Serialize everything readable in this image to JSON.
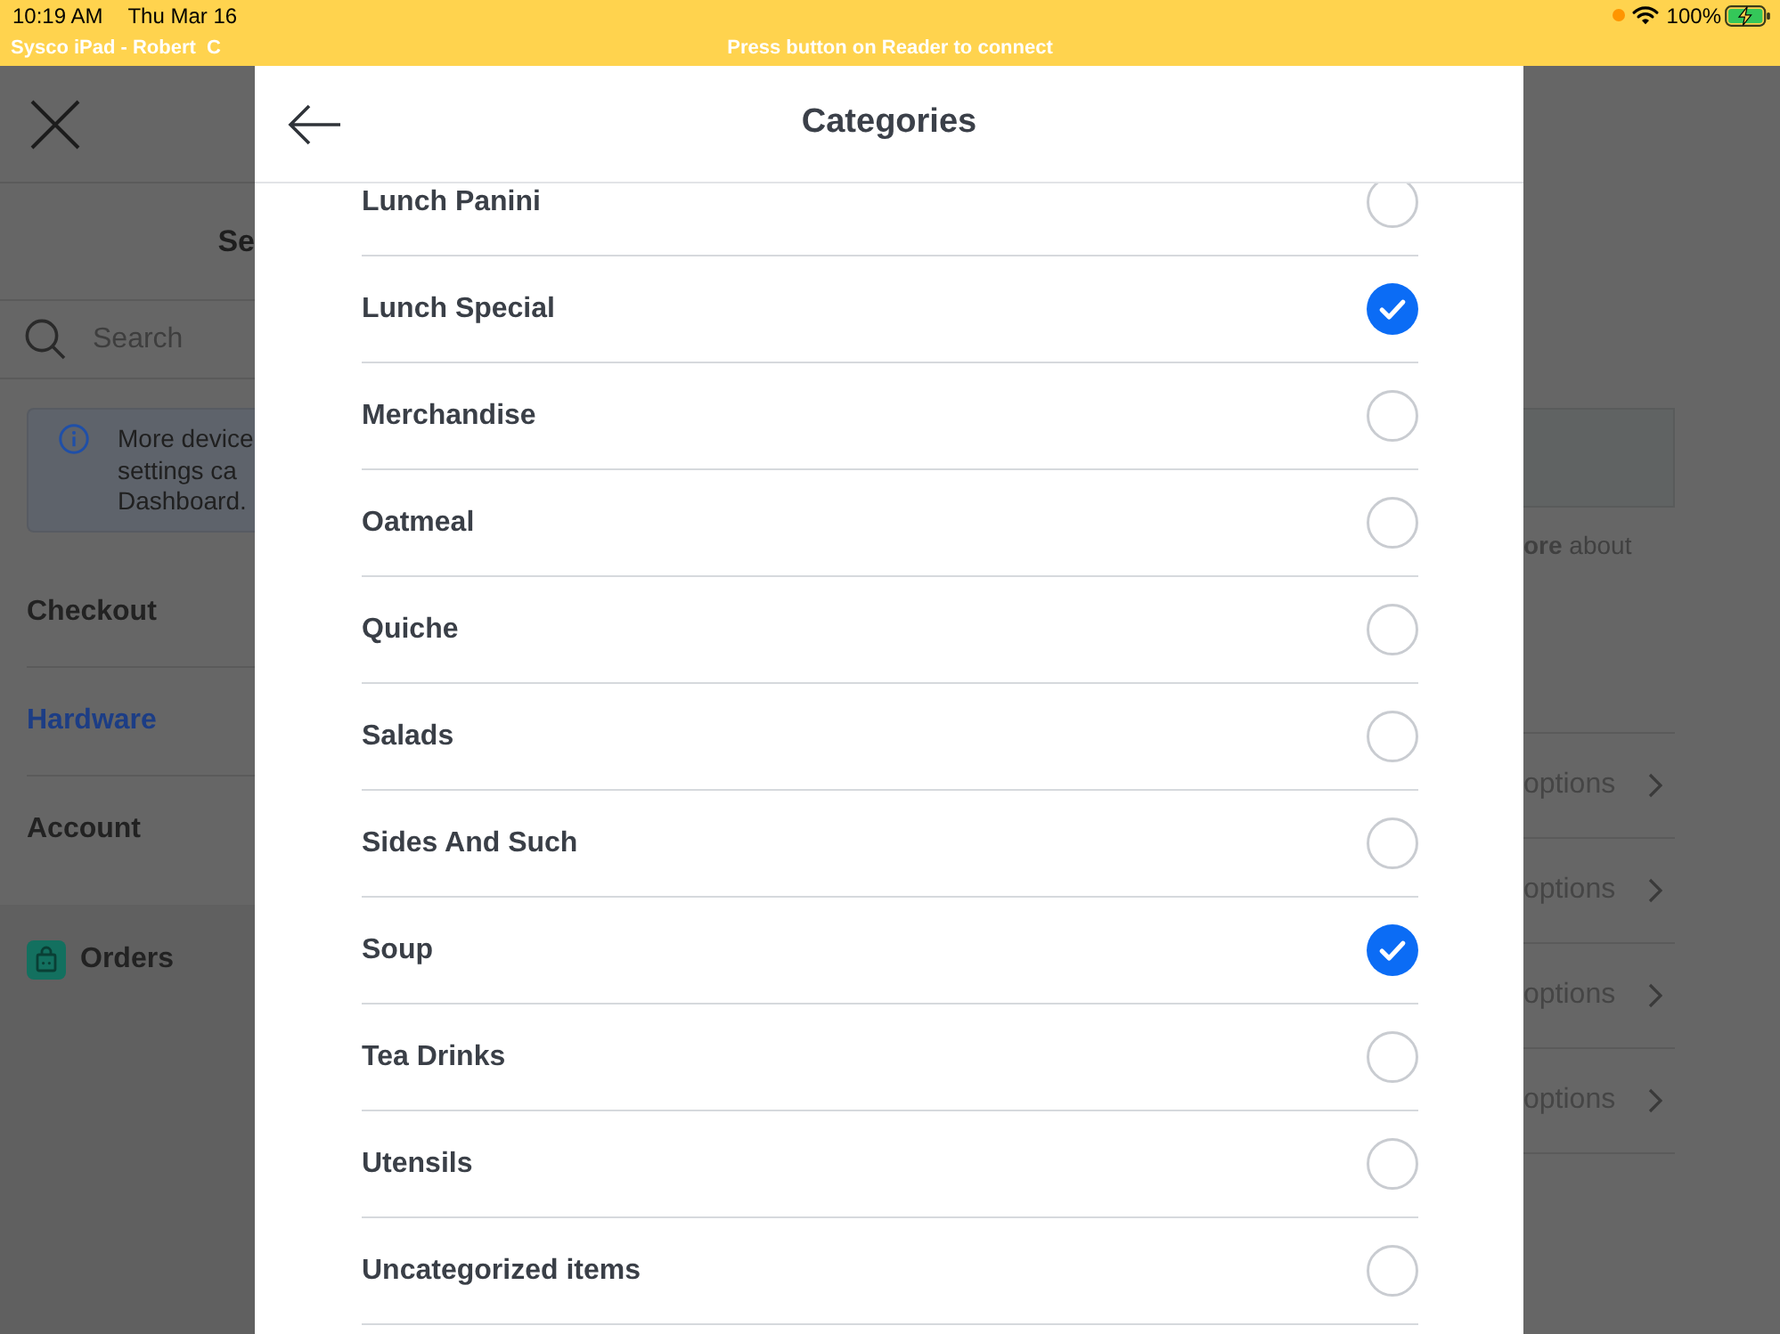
{
  "status_bar": {
    "time": "10:19 AM",
    "date": "Thu Mar 16",
    "battery": "100%",
    "device_name": "Sysco iPad - Robert  C",
    "message": "Press button on Reader to connect"
  },
  "background_left": {
    "title": "Se",
    "search": {
      "placeholder": "Search"
    },
    "notice": {
      "lines": [
        "More device",
        "settings ca",
        "Dashboard."
      ]
    },
    "nav_items": [
      {
        "label": "Checkout",
        "selected": false
      },
      {
        "label": "Hardware",
        "selected": true
      },
      {
        "label": "Account",
        "selected": false
      }
    ],
    "orders": {
      "label": "Orders"
    }
  },
  "background_right": {
    "note": "**ore** about",
    "rows": [
      {
        "label": "options"
      },
      {
        "label": "options"
      },
      {
        "label": "options"
      },
      {
        "label": "options"
      }
    ]
  },
  "modal": {
    "title": "Categories",
    "categories": [
      {
        "label": "Lunch Panini",
        "checked": false
      },
      {
        "label": "Lunch Special",
        "checked": true
      },
      {
        "label": "Merchandise",
        "checked": false
      },
      {
        "label": "Oatmeal",
        "checked": false
      },
      {
        "label": "Quiche",
        "checked": false
      },
      {
        "label": "Salads",
        "checked": false
      },
      {
        "label": "Sides And Such",
        "checked": false
      },
      {
        "label": "Soup",
        "checked": true
      },
      {
        "label": "Tea Drinks",
        "checked": false
      },
      {
        "label": "Utensils",
        "checked": false
      },
      {
        "label": "Uncategorized items",
        "checked": false
      }
    ]
  }
}
